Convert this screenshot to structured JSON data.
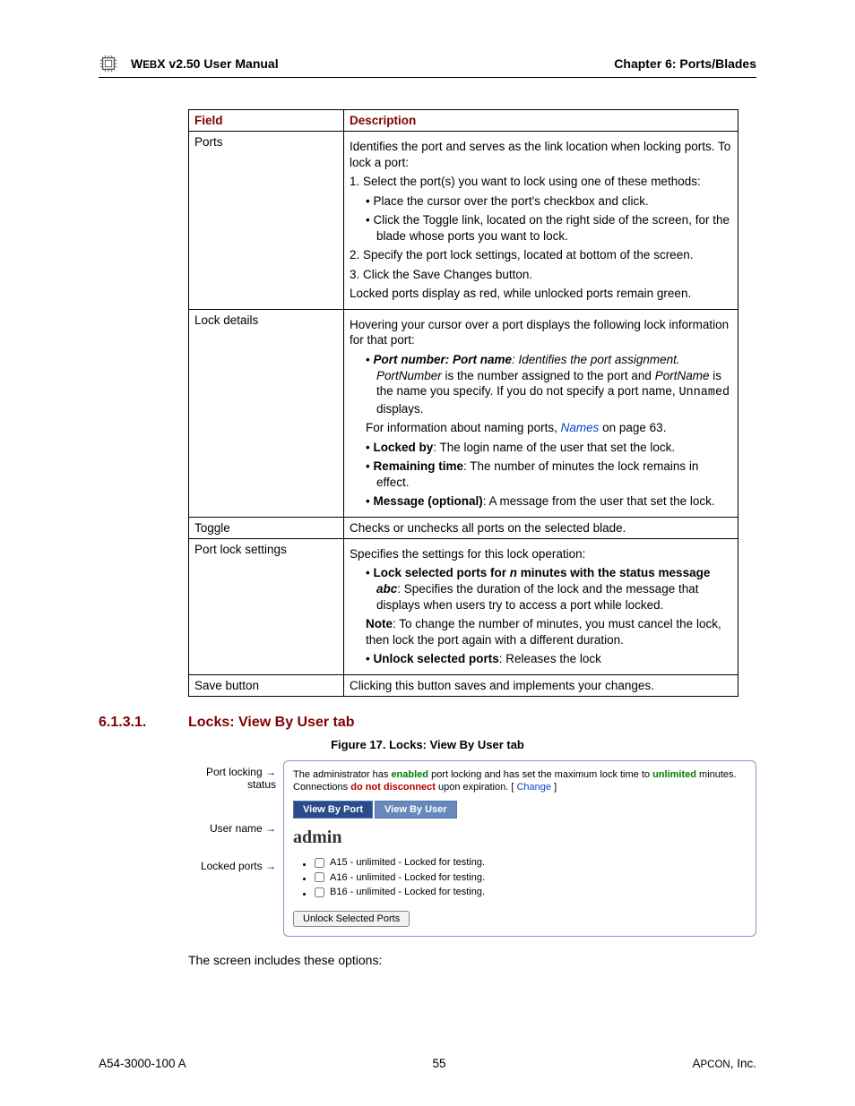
{
  "header": {
    "left_prefix": "W",
    "left_sc": "EB",
    "left_rest": "X v2.50 User Manual",
    "right": "Chapter 6: Ports/Blades"
  },
  "table": {
    "col_field": "Field",
    "col_desc": "Description",
    "rows": {
      "ports": {
        "field": "Ports",
        "p1": "Identifies the port and serves as the link location when locking ports. To lock a port:",
        "p2": "1. Select the port(s) you want to lock using one of these methods:",
        "b1": "Place the cursor over the port's checkbox and click.",
        "b2": "Click the Toggle link, located on the right side of the screen, for the blade whose ports you want to lock.",
        "p3": "2. Specify the port lock settings, located at bottom of the screen.",
        "p4": "3. Click the Save Changes button.",
        "p5": "Locked ports display as red, while unlocked ports remain green."
      },
      "lock_details": {
        "field": "Lock details",
        "p1": "Hovering your cursor over a port displays the following lock information for that port:",
        "b1_bi1": "Port number: Port name",
        "b1_rest_a": ": Identifies the port assignment. ",
        "b1_i2": "PortNumber",
        "b1_rest_b": " is the number assigned to the port and ",
        "b1_i3": "PortName",
        "b1_rest_c": " is the name you specify. If you do not specify a port name, ",
        "b1_m": "Unnamed",
        "b1_rest_d": " displays.",
        "p2_a": "For information about naming ports, ",
        "p2_link": "Names",
        "p2_b": " on page 63.",
        "b2_b": "Locked by",
        "b2_rest": ": The login name of the user that set the lock.",
        "b3_b": "Remaining time",
        "b3_rest": ": The number of minutes the lock remains in effect.",
        "b4_b": "Message (optional)",
        "b4_rest": ": A message from the user that set the lock."
      },
      "toggle": {
        "field": "Toggle",
        "desc": "Checks or unchecks all ports on the selected blade."
      },
      "port_lock": {
        "field": "Port lock settings",
        "p1": "Specifies the settings for this lock operation:",
        "b1_b1": "Lock selected ports for ",
        "b1_bi1": "n",
        "b1_b2": " minutes with the status message ",
        "b1_bi2": "abc",
        "b1_rest": ": Specifies the duration of the lock and the message that displays when users try to access a port while locked.",
        "p2_b": "Note",
        "p2_rest": ": To change the number of minutes, you must cancel the lock, then lock the port again with a different duration.",
        "b2_b": "Unlock  selected ports",
        "b2_rest": ": Releases the lock"
      },
      "save": {
        "field": "Save button",
        "desc": "Clicking this button saves and implements your changes."
      }
    }
  },
  "section": {
    "num": "6.1.3.1.",
    "title": "Locks: View By User tab",
    "fig": "Figure 17. Locks: View By User tab"
  },
  "callouts": {
    "c1a": "Port locking",
    "c1b": "status",
    "c2": "User name",
    "c3": "Locked ports"
  },
  "screenshot": {
    "msg_a": "The administrator has ",
    "msg_en": "enabled",
    "msg_b": " port locking and has set the maximum lock time to ",
    "msg_un": "unlimited",
    "msg_c": " minutes. Connections ",
    "msg_dn": "do not disconnect",
    "msg_d": " upon expiration. [ ",
    "msg_chg": "Change",
    "msg_e": " ]",
    "tab1": "View By Port",
    "tab2": "View By User",
    "user": "admin",
    "ports": [
      "A15 - unlimited - Locked for testing.",
      "A16 - unlimited - Locked for testing.",
      "B16 - unlimited - Locked for testing."
    ],
    "btn": "Unlock Selected Ports"
  },
  "after_fig": "The screen includes these options:",
  "footer": {
    "left": "A54-3000-100 A",
    "center": "55",
    "right_a": "A",
    "right_sc": "PCON",
    "right_b": ", Inc."
  }
}
